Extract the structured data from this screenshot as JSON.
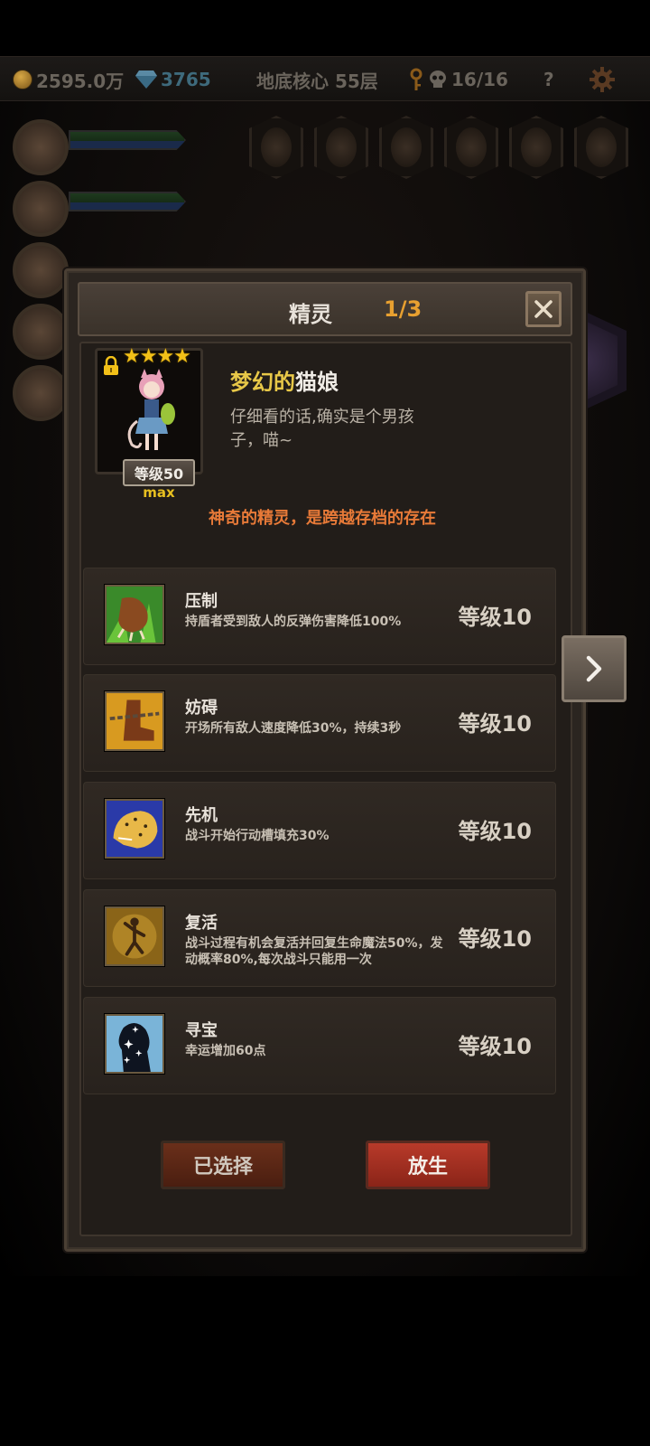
{
  "topbar": {
    "gold": "2595.0万",
    "gems": "3765",
    "floor": "地底核心 55层",
    "dungeon_progress": "16/16",
    "help_label": "?"
  },
  "modal": {
    "title": "精灵",
    "page": "1/3",
    "pet": {
      "stars": "★★★★",
      "level_label": "等级50",
      "max_label": "max",
      "name_prefix": "梦幻的",
      "name_suffix": "猫娘",
      "description": "仔细看的话,确实是个男孩子，喵~",
      "tagline": "神奇的精灵，是跨越存档的存在"
    },
    "skills": [
      {
        "name": "压制",
        "description": "持盾者受到敌人的反弹伤害降低100%",
        "level": "等级10",
        "icon": "claw-icon"
      },
      {
        "name": "妨碍",
        "description": "开场所有敌人速度降低30%，持续3秒",
        "level": "等级10",
        "icon": "chained-boot-icon"
      },
      {
        "name": "先机",
        "description": "战斗开始行动槽填充30%",
        "level": "等级10",
        "icon": "leopard-icon"
      },
      {
        "name": "复活",
        "description": "战斗过程有机会复活并回复生命魔法50%，发动概率80%,每次战斗只能用一次",
        "level": "等级10",
        "icon": "revive-figure-icon"
      },
      {
        "name": "寻宝",
        "description": "幸运增加60点",
        "level": "等级10",
        "icon": "sparkle-silhouette-icon"
      }
    ],
    "buttons": {
      "selected": "已选择",
      "release": "放生"
    }
  },
  "colors": {
    "accent_gold": "#e8c848",
    "page_orange": "#e8a030",
    "tagline_orange": "#e87a38",
    "release_red": "#b83a2a"
  }
}
